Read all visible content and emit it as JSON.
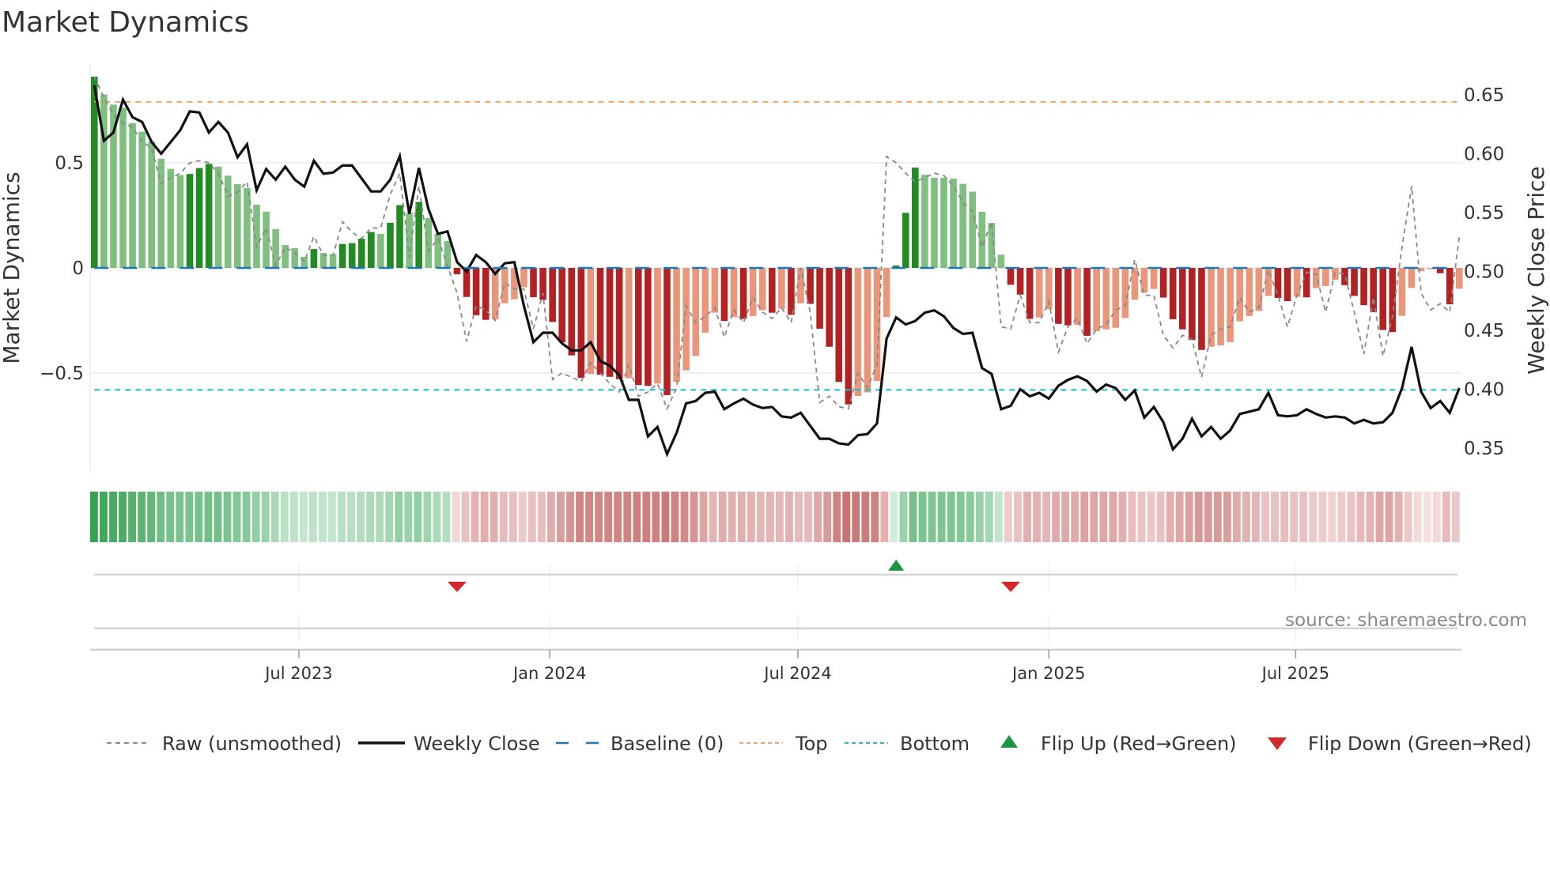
{
  "title": "Market Dynamics",
  "source": "source: sharemaestro.com",
  "chart_data": {
    "type": "bar",
    "title": "Market Dynamics",
    "ylabel": "Market Dynamics",
    "y2label": "Weekly Close Price",
    "ylim": [
      -0.97,
      0.97
    ],
    "y2lim": [
      0.329,
      0.676
    ],
    "yticks": [
      {
        "v": 0.5,
        "label": "0.5"
      },
      {
        "v": 0,
        "label": "0"
      },
      {
        "v": -0.5,
        "label": "−0.5"
      }
    ],
    "y2ticks": [
      {
        "v": 0.65,
        "label": "0.65"
      },
      {
        "v": 0.6,
        "label": "0.60"
      },
      {
        "v": 0.55,
        "label": "0.55"
      },
      {
        "v": 0.5,
        "label": "0.50"
      },
      {
        "v": 0.45,
        "label": "0.45"
      },
      {
        "v": 0.4,
        "label": "0.40"
      },
      {
        "v": 0.35,
        "label": "0.35"
      }
    ],
    "xticks": [
      {
        "date": "2023-07-01",
        "label": "Jul 2023"
      },
      {
        "date": "2024-01-01",
        "label": "Jan 2024"
      },
      {
        "date": "2024-07-01",
        "label": "Jul 2024"
      },
      {
        "date": "2025-01-01",
        "label": "Jan 2025"
      },
      {
        "date": "2025-07-01",
        "label": "Jul 2025"
      }
    ],
    "start_date": "2023-02-01",
    "frequency": "weekly",
    "grid": true,
    "legend_position": "bottom",
    "top_level": 0.79,
    "bottom_level": -0.58,
    "baseline": 0,
    "dynamics": [
      0.91,
      0.825,
      0.777,
      0.762,
      0.689,
      0.648,
      0.601,
      0.52,
      0.471,
      0.442,
      0.447,
      0.475,
      0.495,
      0.482,
      0.439,
      0.399,
      0.38,
      0.301,
      0.268,
      0.185,
      0.109,
      0.095,
      0.053,
      0.09,
      0.071,
      0.066,
      0.114,
      0.118,
      0.139,
      0.171,
      0.162,
      0.215,
      0.299,
      0.262,
      0.314,
      0.237,
      0.163,
      0.128,
      -0.03,
      -0.138,
      -0.225,
      -0.247,
      -0.244,
      -0.168,
      -0.149,
      -0.092,
      -0.139,
      -0.152,
      -0.257,
      -0.354,
      -0.416,
      -0.523,
      -0.504,
      -0.508,
      -0.518,
      -0.529,
      -0.525,
      -0.557,
      -0.561,
      -0.55,
      -0.605,
      -0.542,
      -0.487,
      -0.418,
      -0.308,
      -0.213,
      -0.252,
      -0.234,
      -0.242,
      -0.229,
      -0.201,
      -0.213,
      -0.194,
      -0.223,
      -0.168,
      -0.171,
      -0.289,
      -0.375,
      -0.542,
      -0.649,
      -0.609,
      -0.592,
      -0.538,
      -0.234,
      0.012,
      0.262,
      0.477,
      0.443,
      0.429,
      0.429,
      0.425,
      0.4,
      0.363,
      0.267,
      0.214,
      0.063,
      -0.08,
      -0.127,
      -0.242,
      -0.235,
      -0.197,
      -0.266,
      -0.273,
      -0.27,
      -0.323,
      -0.301,
      -0.292,
      -0.285,
      -0.238,
      -0.151,
      -0.118,
      -0.1,
      -0.141,
      -0.244,
      -0.292,
      -0.343,
      -0.39,
      -0.375,
      -0.368,
      -0.353,
      -0.254,
      -0.229,
      -0.204,
      -0.133,
      -0.143,
      -0.158,
      -0.137,
      -0.14,
      -0.096,
      -0.086,
      -0.057,
      -0.082,
      -0.133,
      -0.177,
      -0.21,
      -0.295,
      -0.305,
      -0.228,
      -0.095,
      -0.016,
      -0.005,
      -0.025,
      -0.173,
      -0.099
    ],
    "raw": [
      0.91,
      0.81,
      0.73,
      0.69,
      0.67,
      0.6,
      0.57,
      0.4,
      0.43,
      0.45,
      0.5,
      0.51,
      0.5,
      0.45,
      0.34,
      0.36,
      0.41,
      0.1,
      0.19,
      0.01,
      0.1,
      0.07,
      0.03,
      0.15,
      0.06,
      0.06,
      0.22,
      0.17,
      0.14,
      0.19,
      0.19,
      0.35,
      0.45,
      0.05,
      0.39,
      0.08,
      0.14,
      0.01,
      -0.12,
      -0.35,
      -0.18,
      -0.2,
      -0.25,
      -0.07,
      -0.1,
      -0.1,
      -0.29,
      -0.12,
      -0.53,
      -0.5,
      -0.52,
      -0.54,
      -0.45,
      -0.5,
      -0.55,
      -0.59,
      -0.46,
      -0.61,
      -0.59,
      -0.55,
      -0.67,
      -0.57,
      -0.18,
      -0.26,
      -0.23,
      -0.19,
      -0.33,
      -0.2,
      -0.26,
      -0.14,
      -0.21,
      -0.24,
      -0.19,
      -0.26,
      0.0,
      -0.21,
      -0.64,
      -0.61,
      -0.66,
      -0.67,
      -0.5,
      -0.57,
      -0.46,
      0.53,
      0.5,
      0.45,
      0.41,
      0.43,
      0.45,
      0.44,
      0.39,
      0.31,
      0.27,
      0.1,
      0.22,
      -0.28,
      -0.29,
      -0.13,
      -0.26,
      -0.26,
      -0.16,
      -0.4,
      -0.28,
      -0.24,
      -0.36,
      -0.29,
      -0.27,
      -0.2,
      -0.18,
      0.04,
      -0.13,
      -0.13,
      -0.32,
      -0.38,
      -0.32,
      -0.34,
      -0.52,
      -0.32,
      -0.29,
      -0.28,
      -0.14,
      -0.21,
      -0.19,
      -0.01,
      -0.13,
      -0.28,
      -0.13,
      -0.02,
      -0.03,
      -0.21,
      -0.02,
      -0.03,
      -0.21,
      -0.41,
      -0.14,
      -0.42,
      -0.23,
      0.1,
      0.39,
      -0.12,
      -0.2,
      -0.17,
      -0.21,
      0.15
    ],
    "weekly_close": [
      0.658,
      0.611,
      0.618,
      0.646,
      0.631,
      0.627,
      0.61,
      0.6,
      0.61,
      0.62,
      0.636,
      0.635,
      0.618,
      0.627,
      0.618,
      0.597,
      0.608,
      0.569,
      0.587,
      0.578,
      0.589,
      0.578,
      0.572,
      0.594,
      0.583,
      0.584,
      0.59,
      0.59,
      0.579,
      0.568,
      0.568,
      0.578,
      0.598,
      0.549,
      0.588,
      0.553,
      0.532,
      0.534,
      0.508,
      0.5,
      0.514,
      0.508,
      0.498,
      0.507,
      0.508,
      0.471,
      0.44,
      0.448,
      0.448,
      0.439,
      0.433,
      0.433,
      0.44,
      0.424,
      0.42,
      0.412,
      0.391,
      0.391,
      0.36,
      0.368,
      0.345,
      0.363,
      0.388,
      0.39,
      0.397,
      0.398,
      0.383,
      0.388,
      0.392,
      0.387,
      0.384,
      0.385,
      0.377,
      0.376,
      0.38,
      0.369,
      0.358,
      0.358,
      0.354,
      0.353,
      0.361,
      0.362,
      0.371,
      0.443,
      0.461,
      0.455,
      0.458,
      0.465,
      0.467,
      0.462,
      0.452,
      0.447,
      0.448,
      0.418,
      0.413,
      0.383,
      0.386,
      0.4,
      0.394,
      0.397,
      0.392,
      0.403,
      0.408,
      0.411,
      0.407,
      0.398,
      0.404,
      0.401,
      0.391,
      0.399,
      0.376,
      0.385,
      0.372,
      0.349,
      0.358,
      0.375,
      0.36,
      0.368,
      0.358,
      0.365,
      0.379,
      0.381,
      0.383,
      0.397,
      0.378,
      0.377,
      0.378,
      0.383,
      0.379,
      0.376,
      0.377,
      0.376,
      0.371,
      0.374,
      0.371,
      0.372,
      0.38,
      0.401,
      0.436,
      0.398,
      0.384,
      0.39,
      0.38,
      0.401
    ],
    "flips": [
      {
        "date": "2023-10-25",
        "type": "down"
      },
      {
        "date": "2024-09-11",
        "type": "up"
      },
      {
        "date": "2024-12-04",
        "type": "down"
      }
    ],
    "colors": {
      "pos_strong": "#228b22",
      "pos_weak": "#7fbf7f",
      "neg_strong": "#b22222",
      "neg_weak": "#e9967a",
      "heat_pos_light": "#d6eede",
      "heat_pos_dark": "#36a352",
      "heat_neg_light": "#f5e0e0",
      "heat_neg_dark": "#c97471",
      "raw": "#888888",
      "close": "#111111",
      "baseline": "#1f77b4",
      "top": "#f4a460",
      "bottom": "#17becf",
      "flip_up": "#1a9641",
      "flip_down": "#d62728"
    }
  },
  "legend": [
    {
      "label": "Raw (unsmoothed)",
      "key": "raw"
    },
    {
      "label": "Weekly Close",
      "key": "close"
    },
    {
      "label": "Baseline (0)",
      "key": "baseline"
    },
    {
      "label": "Top",
      "key": "top"
    },
    {
      "label": "Bottom",
      "key": "bottom"
    },
    {
      "label": "Flip Up (Red→Green)",
      "key": "flip_up"
    },
    {
      "label": "Flip Down (Green→Red)",
      "key": "flip_down"
    }
  ]
}
